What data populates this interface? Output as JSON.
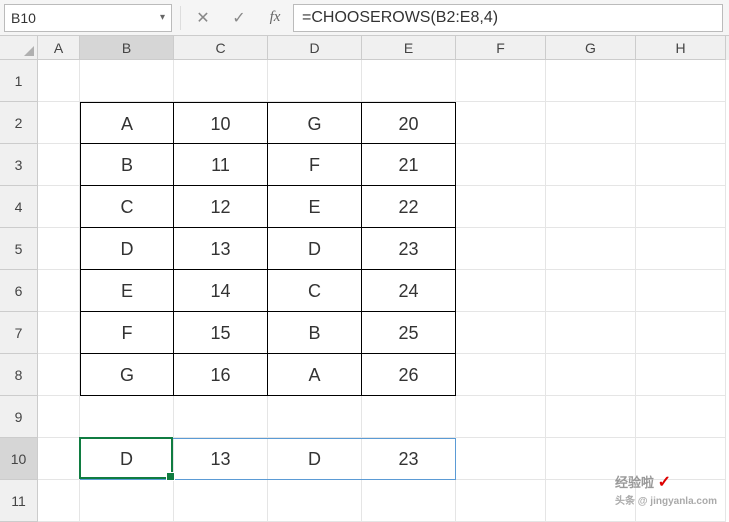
{
  "name_box": "B10",
  "formula": "=CHOOSEROWS(B2:E8,4)",
  "columns": [
    "A",
    "B",
    "C",
    "D",
    "E",
    "F",
    "G",
    "H"
  ],
  "active_col": "B",
  "active_row": "10",
  "row_labels": [
    "1",
    "2",
    "3",
    "4",
    "5",
    "6",
    "7",
    "8",
    "9",
    "10",
    "11"
  ],
  "table": [
    [
      "A",
      "10",
      "G",
      "20"
    ],
    [
      "B",
      "11",
      "F",
      "21"
    ],
    [
      "C",
      "12",
      "E",
      "22"
    ],
    [
      "D",
      "13",
      "D",
      "23"
    ],
    [
      "E",
      "14",
      "C",
      "24"
    ],
    [
      "F",
      "15",
      "B",
      "25"
    ],
    [
      "G",
      "16",
      "A",
      "26"
    ]
  ],
  "result_row": [
    "D",
    "13",
    "D",
    "23"
  ],
  "chart_data": {
    "type": "table",
    "source_range": "B2:E8",
    "data": [
      [
        "A",
        10,
        "G",
        20
      ],
      [
        "B",
        11,
        "F",
        21
      ],
      [
        "C",
        12,
        "E",
        22
      ],
      [
        "D",
        13,
        "D",
        23
      ],
      [
        "E",
        14,
        "C",
        24
      ],
      [
        "F",
        15,
        "B",
        25
      ],
      [
        "G",
        16,
        "A",
        26
      ]
    ],
    "formula": "=CHOOSEROWS(B2:E8,4)",
    "result_range": "B10:E10",
    "result": [
      "D",
      13,
      "D",
      23
    ]
  },
  "watermark": {
    "title": "经验啦",
    "sub": "头条 @ jingyanla.com"
  }
}
